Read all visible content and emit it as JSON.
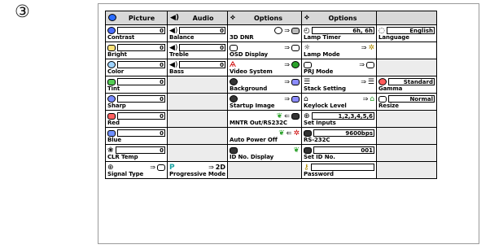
{
  "marker": "③",
  "headers": [
    "Picture",
    "Audio",
    "Options",
    "Options"
  ],
  "picture": {
    "contrast": {
      "value": "0",
      "label": "Contrast"
    },
    "bright": {
      "value": "0",
      "label": "Bright"
    },
    "color": {
      "value": "0",
      "label": "Color"
    },
    "tint": {
      "value": "0",
      "label": "Tint"
    },
    "sharp": {
      "value": "0",
      "label": "Sharp"
    },
    "red": {
      "value": "0",
      "label": "Red"
    },
    "blue": {
      "value": "0",
      "label": "Blue"
    },
    "clr_temp": {
      "value": "0",
      "label": "CLR Temp"
    },
    "signal_type": {
      "label": "Signal Type"
    }
  },
  "audio": {
    "balance": {
      "value": "0",
      "label": "Balance"
    },
    "treble": {
      "value": "0",
      "label": "Treble"
    },
    "bass": {
      "value": "0",
      "label": "Bass"
    },
    "progressive": {
      "value": "2D",
      "label": "Progressive Mode"
    }
  },
  "options1": {
    "dnr": {
      "label": "3D DNR"
    },
    "osd": {
      "label": "OSD Display"
    },
    "video_system": {
      "label": "Video System"
    },
    "background": {
      "label": "Background"
    },
    "startup": {
      "label": "Startup Image"
    },
    "mntr": {
      "label": "MNTR Out/RS232C"
    },
    "auto_power_off": {
      "label": "Auto Power Off"
    },
    "id_display": {
      "label": "ID No. Display"
    }
  },
  "options2": {
    "lamp_timer": {
      "value": "6h,  6h",
      "label": "Lamp Timer"
    },
    "lamp_mode": {
      "label": "Lamp Mode"
    },
    "prj_mode": {
      "label": "PRJ Mode"
    },
    "stack": {
      "label": "Stack Setting"
    },
    "keylock": {
      "label": "Keylock Level"
    },
    "set_inputs": {
      "value": "1,2,3,4,5,6",
      "label": "Set Inputs"
    },
    "rs232c": {
      "value": "9600bps",
      "label": "RS-232C"
    },
    "set_id": {
      "value": "001",
      "label": "Set ID No."
    },
    "password": {
      "value": "",
      "label": "Password"
    }
  },
  "col5": {
    "language": {
      "value": "English",
      "label": "Language"
    },
    "gamma": {
      "value": "Standard",
      "label": "Gamma"
    },
    "resize": {
      "value": "Normal",
      "label": "Resize"
    }
  },
  "colors": {
    "header_bg": "#d8d8d8",
    "contrast": "#4a6cff",
    "bright": "#c8a200",
    "color": "#3a9ad9",
    "tint": "#55cc55",
    "sharp": "#7a8cff",
    "red": "#ff6060",
    "blue": "#7090ff",
    "progressive": "#1aa3a3",
    "gamma": "#ff5a5a"
  }
}
